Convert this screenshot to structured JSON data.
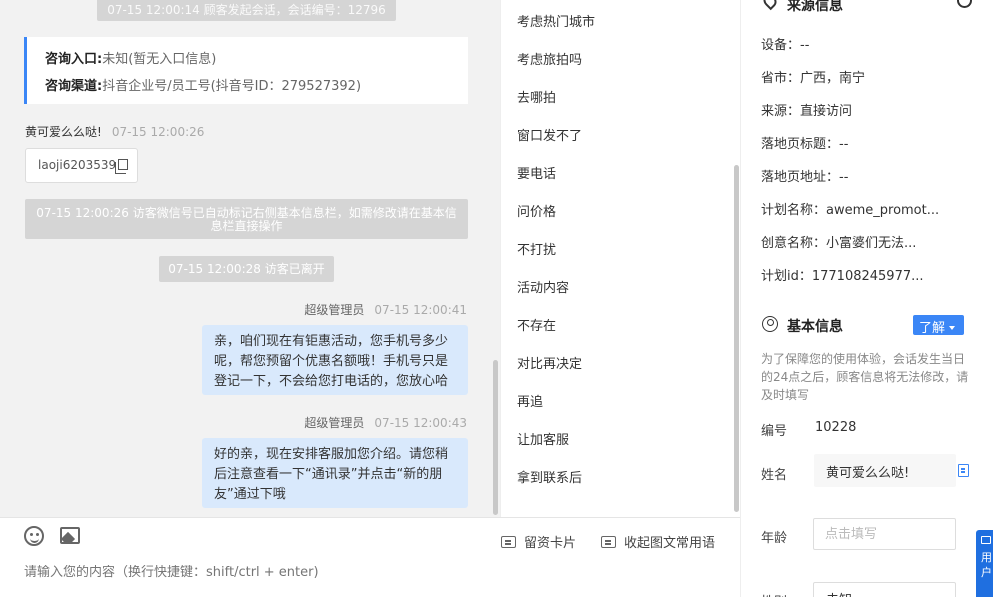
{
  "chat": {
    "system_top": "07-15 12:00:14 顾客发起会话，会话编号：12796",
    "entry": {
      "label": "咨询入口:",
      "value": "未知(暂无入口信息)"
    },
    "channel": {
      "label": "咨询渠道:",
      "value": "抖音企业号/员工号(抖音号ID：279527392)"
    },
    "visitor_name": "黄可爱么么哒!",
    "visitor_time": "07-15 12:00:26",
    "wechat_id": "laoji6203539",
    "system_mark": "07-15 12:00:26 访客微信号已自动标记右侧基本信息栏，如需修改请在基本信息栏直接操作",
    "system_left": "07-15 12:00:28 访客已离开",
    "agent_name": "超级管理员",
    "msg1_time": "07-15 12:00:41",
    "msg1": "亲，咱们现在有钜惠活动，您手机号多少呢，帮您预留个优惠名额哦！手机号只是登记一下，不会给您打电话的，您放心哈",
    "msg2_time": "07-15 12:00:43",
    "msg2": "好的亲，现在安排客服加您介绍。请您稍后注意查看一下“通讯录”并点击“新的朋友”通过下哦"
  },
  "input": {
    "card_btn": "留资卡片",
    "fold_btn": "收起图文常用语",
    "placeholder": "请输入您的内容（换行快捷键：shift/ctrl + enter)"
  },
  "tags": [
    "考虑热门城市",
    "考虑旅拍吗",
    "去哪拍",
    "窗口发不了",
    "要电话",
    "问价格",
    "不打扰",
    "活动内容",
    "不存在",
    "对比再决定",
    "再追",
    "让加客服",
    "拿到联系后"
  ],
  "source": {
    "title": "来源信息",
    "device": "设备：--",
    "region": "省市：广西，南宁",
    "origin": "来源：直接访问",
    "landing_title": "落地页标题：--",
    "landing_url": "落地页地址：--",
    "plan_name": "计划名称：aweme_promot...",
    "creative_name": "创意名称：小富婆们无法...",
    "plan_id": "计划id：177108245977..."
  },
  "basic": {
    "title": "基本信息",
    "learn_btn": "了解",
    "notice": "为了保障您的使用体验，会话发生当日的24点之后，顾客信息将无法修改，请及时填写",
    "id_label": "编号",
    "id_value": "10228",
    "name_label": "姓名",
    "name_value": "黄可爱么么哒!",
    "age_label": "年龄",
    "age_placeholder": "点击填写",
    "gender_label": "性别",
    "gender_value": "未知"
  },
  "float_tab": "用户"
}
